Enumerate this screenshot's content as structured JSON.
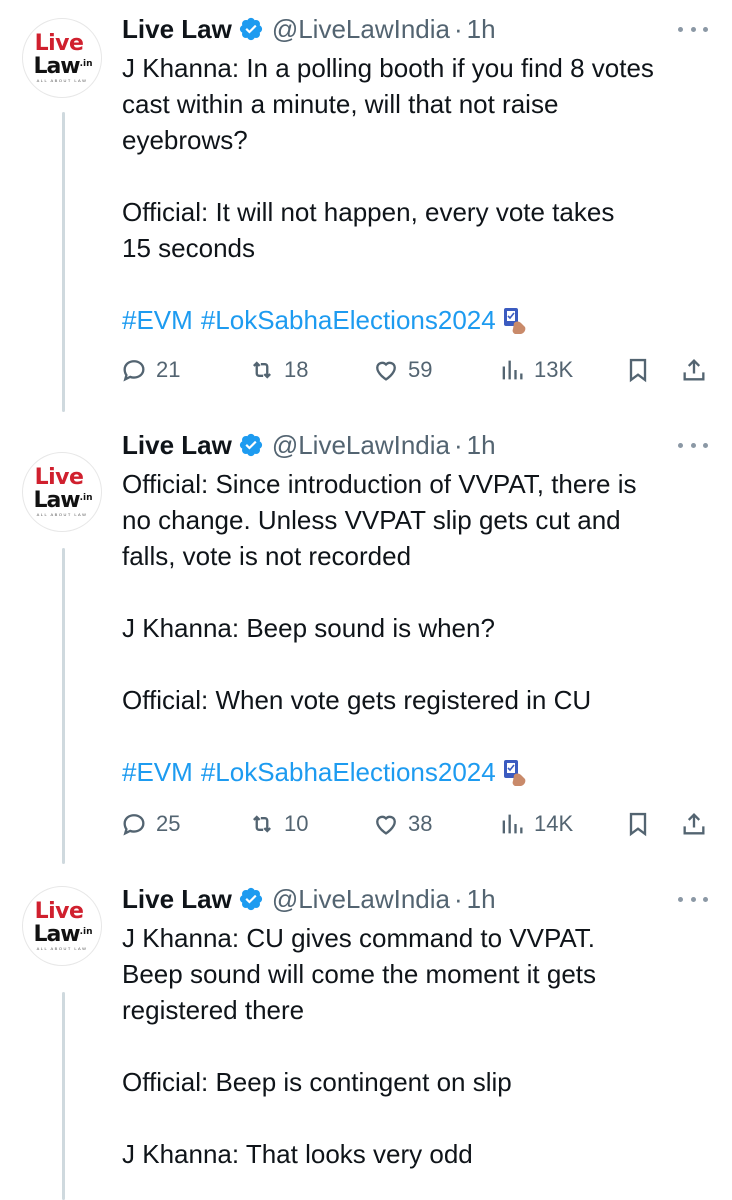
{
  "account": {
    "name": "Live Law",
    "handle": "@LiveLawIndia",
    "separator": "·",
    "logo": {
      "line1": "Live",
      "line2": "Law",
      "suffix": ".in",
      "tagline": "ALL ABOUT LAW"
    }
  },
  "colors": {
    "link": "#1d9bf0",
    "verified": "#1d9bf0",
    "brand_red": "#d0202e",
    "muted": "#536471"
  },
  "tweets": [
    {
      "time": "1h",
      "lines": [
        "J Khanna: In a polling booth if you find 8 votes",
        "cast within a minute, will that not raise",
        "eyebrows?",
        "",
        "Official: It will not happen, every vote takes",
        "15 seconds",
        ""
      ],
      "hashtags": [
        "#EVM",
        "#LokSabhaElections2024"
      ],
      "emoji": "ballot-box-with-hand-icon",
      "stats": {
        "replies": "21",
        "reposts": "18",
        "likes": "59",
        "views": "13K"
      }
    },
    {
      "time": "1h",
      "lines": [
        "Official: Since introduction of VVPAT, there is",
        "no change. Unless VVPAT slip gets cut and",
        "falls, vote is not recorded",
        "",
        "J Khanna: Beep sound is when?",
        "",
        "Official: When vote gets registered in CU",
        ""
      ],
      "hashtags": [
        "#EVM",
        "#LokSabhaElections2024"
      ],
      "emoji": "ballot-box-with-hand-icon",
      "stats": {
        "replies": "25",
        "reposts": "10",
        "likes": "38",
        "views": "14K"
      }
    },
    {
      "time": "1h",
      "lines": [
        "J Khanna: CU gives command to VVPAT.",
        "Beep sound will come the moment it gets",
        "registered there",
        "",
        "Official: Beep is contingent on slip",
        "",
        "J Khanna: That looks very odd"
      ]
    }
  ]
}
